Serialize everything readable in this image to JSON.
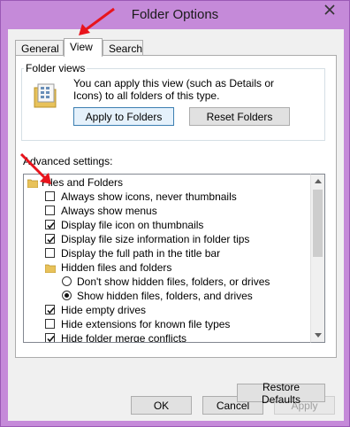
{
  "window": {
    "title": "Folder Options",
    "close_glyph": "✕"
  },
  "tabs": [
    {
      "label": "General",
      "active": false
    },
    {
      "label": "View",
      "active": true
    },
    {
      "label": "Search",
      "active": false
    }
  ],
  "folder_views": {
    "label": "Folder views",
    "description": "You can apply this view (such as Details or Icons) to all folders of this type.",
    "apply_button": "Apply to Folders",
    "reset_button": "Reset Folders"
  },
  "advanced": {
    "label": "Advanced settings:",
    "items": [
      {
        "kind": "folder",
        "label": "Files and Folders"
      },
      {
        "kind": "checkbox",
        "checked": false,
        "label": "Always show icons, never thumbnails"
      },
      {
        "kind": "checkbox",
        "checked": false,
        "label": "Always show menus"
      },
      {
        "kind": "checkbox",
        "checked": true,
        "label": "Display file icon on thumbnails"
      },
      {
        "kind": "checkbox",
        "checked": true,
        "label": "Display file size information in folder tips"
      },
      {
        "kind": "checkbox",
        "checked": false,
        "label": "Display the full path in the title bar"
      },
      {
        "kind": "folder",
        "label": "Hidden files and folders"
      },
      {
        "kind": "radio",
        "checked": false,
        "label": "Don't show hidden files, folders, or drives"
      },
      {
        "kind": "radio",
        "checked": true,
        "label": "Show hidden files, folders, and drives"
      },
      {
        "kind": "checkbox",
        "checked": true,
        "label": "Hide empty drives"
      },
      {
        "kind": "checkbox",
        "checked": false,
        "label": "Hide extensions for known file types"
      },
      {
        "kind": "checkbox",
        "checked": true,
        "label": "Hide folder merge conflicts"
      }
    ]
  },
  "buttons": {
    "restore_defaults": "Restore Defaults",
    "ok": "OK",
    "cancel": "Cancel",
    "apply": "Apply"
  },
  "colors": {
    "frame": "#c58ad9",
    "annotation_arrow": "#e8141c",
    "folder_icon": "#e8c25a"
  }
}
